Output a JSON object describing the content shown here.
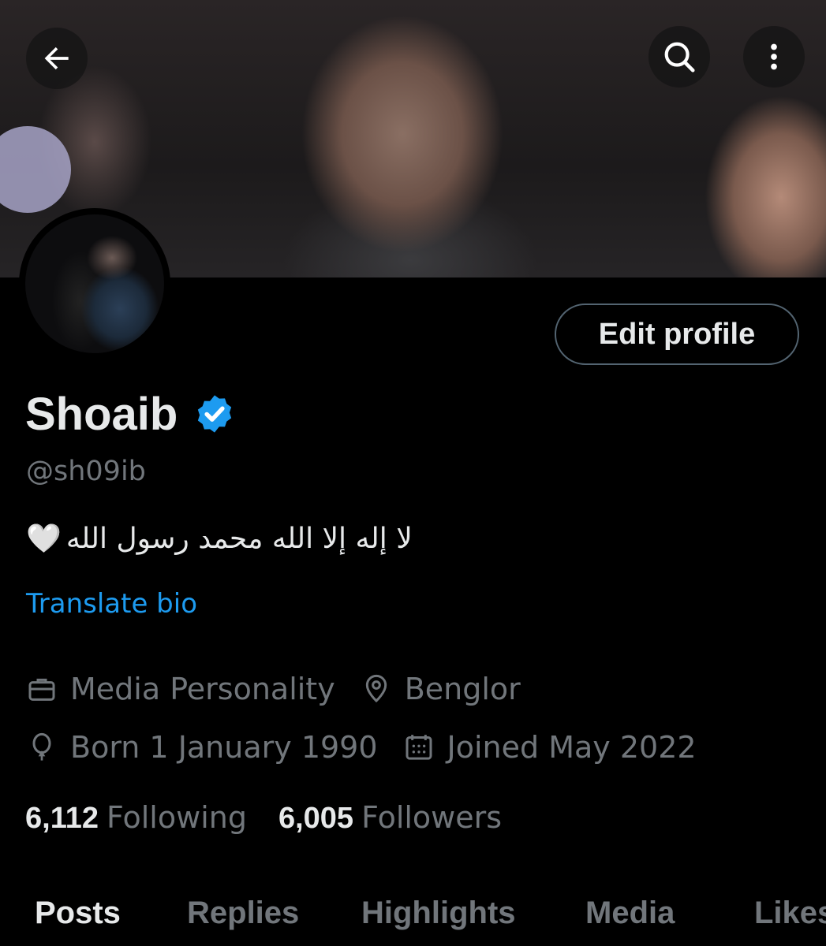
{
  "header": {
    "back_icon": "arrow-left-icon",
    "search_icon": "search-icon",
    "more_icon": "more-vertical-icon"
  },
  "profile": {
    "display_name": "Shoaib",
    "verified_icon": "verified-badge-icon",
    "handle": "@sh09ib",
    "bio_text": "لا إله إلا الله محمد رسول الله",
    "bio_emoji": "🤍",
    "translate_label": "Translate bio",
    "edit_button_label": "Edit profile",
    "category": "Media Personality",
    "location": "Benglor",
    "birth": "Born 1 January 1990",
    "joined": "Joined May 2022"
  },
  "stats": {
    "following_count": "6,112",
    "following_label": "Following",
    "followers_count": "6,005",
    "followers_label": "Followers"
  },
  "tabs": [
    {
      "label": "Posts"
    },
    {
      "label": "Replies"
    },
    {
      "label": "Highlights"
    },
    {
      "label": "Media"
    },
    {
      "label": "Likes"
    }
  ],
  "colors": {
    "background": "#000000",
    "text": "#e7e9ea",
    "muted": "#71767b",
    "link": "#1d9bf0",
    "verified": "#1d9bf0",
    "border": "#536471"
  }
}
